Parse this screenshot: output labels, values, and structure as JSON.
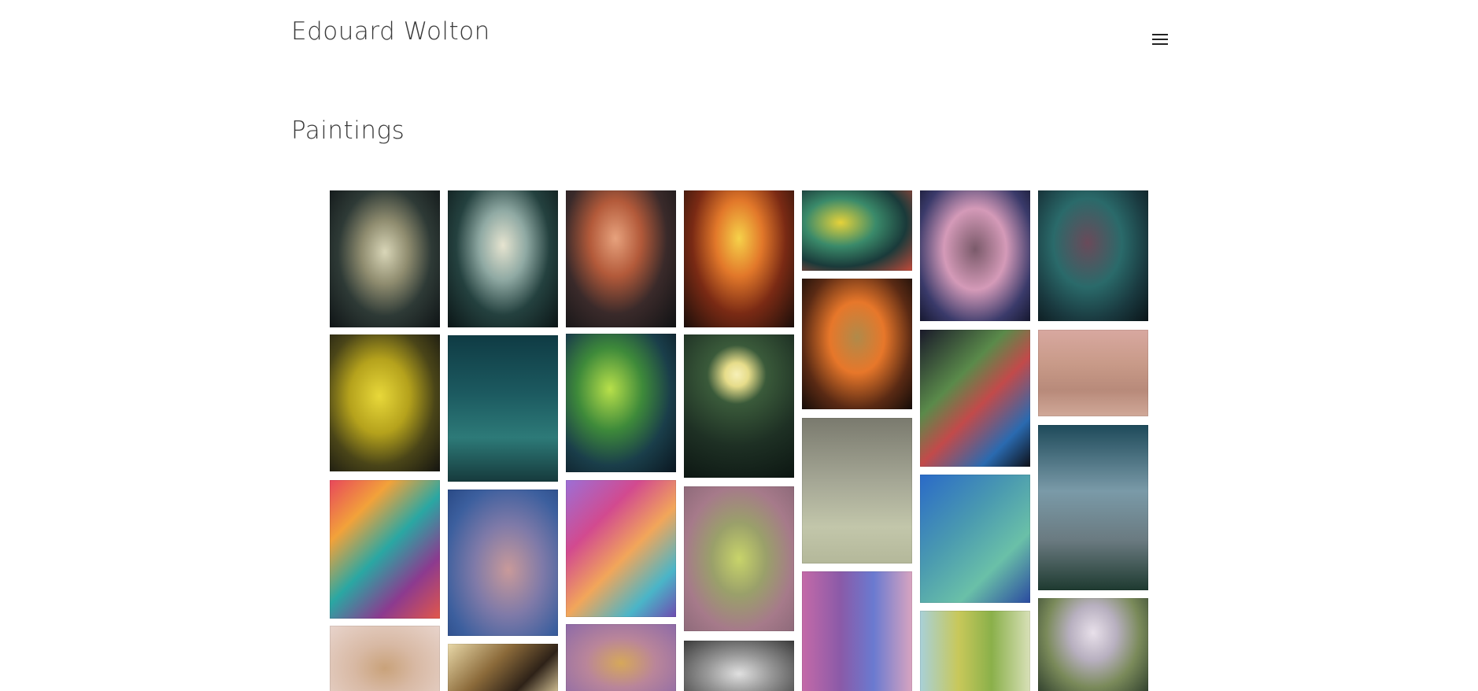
{
  "header": {
    "site_title": "Edouard Wolton",
    "menu_icon": "hamburger-menu-icon"
  },
  "main": {
    "heading": "Paintings"
  },
  "gallery": {
    "columns": [
      {
        "items": [
          {
            "name": "painting-nautilus-shell",
            "bg": "radial-gradient(ellipse at 50% 45%, #d9d6b8 0%, #8f8c6f 30%, #2e3a36 60%, #0f1416 100%)"
          },
          {
            "name": "painting-yellow-stone",
            "bg": "radial-gradient(ellipse at 45% 45%, #e8d83a 0%, #b5a21c 35%, #4a4518 65%, #141410 100%)"
          },
          {
            "name": "painting-colorful-flowers",
            "bg": "linear-gradient(135deg, #e8475b 0%, #f2a23a 25%, #2aa7a3 50%, #8c3a8f 75%, #e2574a 100%)"
          },
          {
            "name": "painting-pink-flower-haze",
            "bg": "radial-gradient(ellipse at 50% 60%, #c9a27a 0%, #d8b9a4 40%, #e8d4cc 100%)"
          }
        ]
      },
      {
        "items": [
          {
            "name": "painting-spiral-shell-cube",
            "bg": "radial-gradient(ellipse at 50% 40%, #e6e4d0 0%, #8fa9a3 30%, #24413f 60%, #0b1516 100%)"
          },
          {
            "name": "painting-teal-landscape",
            "bg": "linear-gradient(180deg, #0f3b44 0%, #1c5a60 40%, #2d7a78 70%, #163a3c 100%)"
          },
          {
            "name": "painting-lily-blue",
            "bg": "radial-gradient(ellipse at 55% 55%, #c99a9a 0%, #7f7aa8 40%, #3c5f9e 75%, #2a4a86 100%)"
          },
          {
            "name": "painting-cliff-light",
            "bg": "linear-gradient(135deg, #e8d8a8 0%, #8b6a3a 40%, #2e2218 70%, #e6d3a3 100%)"
          }
        ]
      },
      {
        "items": [
          {
            "name": "painting-shell-prism",
            "bg": "radial-gradient(ellipse at 45% 35%, #e7a27d 0%, #b35a3a 30%, #3a2a2a 60%, #101214 100%)"
          },
          {
            "name": "painting-green-rock-grapes",
            "bg": "radial-gradient(ellipse at 40% 40%, #b8e04a 0%, #3e8a3a 35%, #1a3e4a 65%, #0a1620 100%)"
          },
          {
            "name": "painting-purple-daisies",
            "bg": "linear-gradient(135deg, #9c6fd6 0%, #d24a8f 30%, #f2a65a 55%, #4ab5c8 80%, #6e4bb0 100%)"
          },
          {
            "name": "painting-orchid-purple",
            "bg": "radial-gradient(ellipse at 50% 55%, #d6a85a 0%, #b9859a 45%, #8d6aa8 100%)"
          }
        ]
      },
      {
        "items": [
          {
            "name": "painting-fiery-shells",
            "bg": "radial-gradient(ellipse at 50% 35%, #f6d24a 0%, #e2782a 30%, #7a2a14 60%, #1a0e0a 100%)"
          },
          {
            "name": "painting-moon-green",
            "bg": "radial-gradient(circle at 48% 28%, #f7f0b8 0%, #e6dc8a 10%, #3a5a3a 25%, #1e3024 60%, #0c1612 100%)"
          },
          {
            "name": "painting-yellow-green-plant",
            "bg": "radial-gradient(ellipse at 50% 50%, #c8d46a 0%, #9aa06a 35%, #a67a8a 70%, #8e6a7a 100%)"
          },
          {
            "name": "painting-crystal-grey",
            "bg": "radial-gradient(ellipse at 50% 60%, #e0e0e0 0%, #9a9a9a 40%, #3a3a3a 100%)"
          }
        ]
      },
      {
        "items": [
          {
            "name": "painting-geometric-still-life",
            "bg": "radial-gradient(ellipse at 35% 40%, #e6d23a 0%, #3a8a6a 35%, #1a3a3a 65%, #c24a3a 100%)"
          },
          {
            "name": "painting-crystal-orange",
            "bg": "radial-gradient(ellipse at 50% 45%, #b08a4a 0%, #e7772a 35%, #5a2a14 70%, #140c08 100%)"
          },
          {
            "name": "painting-grey-pebble",
            "bg": "linear-gradient(180deg, #7a7a6e 0%, #a6a896 45%, #c2c6aa 75%, #b4b89a 100%)"
          },
          {
            "name": "painting-magenta-bloom",
            "bg": "linear-gradient(90deg, #c46aa8 0%, #8a5aa8 35%, #6a7ad0 65%, #d8a4c0 100%)"
          }
        ]
      },
      {
        "items": [
          {
            "name": "painting-dark-crystal-sky",
            "bg": "radial-gradient(ellipse at 50% 45%, #7a5a6a 0%, #d49ab8 40%, #3a3a6a 75%, #161830 100%)"
          },
          {
            "name": "painting-rainbow-mountain",
            "bg": "linear-gradient(135deg, #1a1a2a 0%, #5a8a4a 35%, #c24a4a 55%, #2a6ab0 80%, #0e1018 100%)"
          },
          {
            "name": "painting-blue-leaves",
            "bg": "linear-gradient(135deg, #2a6ac8 0%, #4a9ab0 40%, #6ac0a8 70%, #2a4aa0 100%)"
          },
          {
            "name": "painting-cactus-yellow",
            "bg": "linear-gradient(90deg, #a8d0d8 0%, #c8c85a 35%, #8ab04a 65%, #d8e0b8 100%)"
          }
        ]
      },
      {
        "items": [
          {
            "name": "painting-floating-cube-teal",
            "bg": "radial-gradient(ellipse at 45% 40%, #6a4a5a 0%, #2a6a6a 40%, #1a3a40 70%, #0a1418 100%)"
          },
          {
            "name": "painting-desert-crater",
            "bg": "linear-gradient(180deg, #d8a8a0 0%, #c89a88 40%, #b88a7a 70%, #d0a898 100%)"
          },
          {
            "name": "painting-stone-tower",
            "bg": "linear-gradient(180deg, #1e4a5a 0%, #7a9aa8 40%, #6a7a80 70%, #1e3a30 100%)"
          },
          {
            "name": "painting-thistle",
            "bg": "radial-gradient(ellipse at 50% 35%, #e8e0ea 0%, #b8b0c0 30%, #7a8a5a 60%, #2a3a2a 100%)"
          }
        ]
      }
    ]
  }
}
